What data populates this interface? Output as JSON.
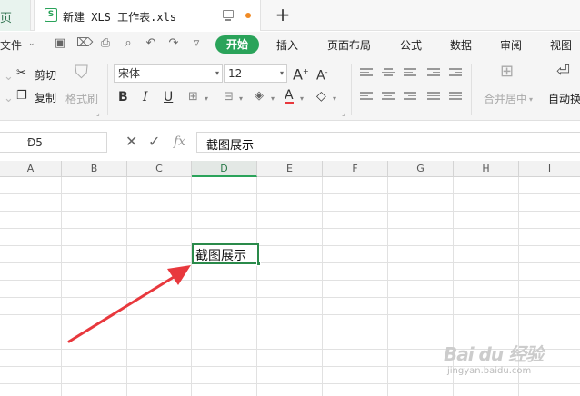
{
  "tabs": {
    "prev_label": "页",
    "active_title": "新建 XLS 工作表.xls",
    "xls_icon": "S",
    "new_tab": "+"
  },
  "menu": {
    "file": "文件",
    "start": "开始",
    "items": [
      "插入",
      "页面布局",
      "公式",
      "数据",
      "审阅",
      "视图"
    ]
  },
  "ribbon": {
    "cut": "剪切",
    "copy": "复制",
    "format_painter": "格式刷",
    "font_name": "宋体",
    "font_size": "12",
    "bold": "B",
    "italic": "I",
    "underline": "U",
    "font_color_letter": "A",
    "merge_center": "合并居中",
    "auto_wrap": "自动换"
  },
  "formula_bar": {
    "cell_ref": "D5",
    "fx": "fx",
    "content": "截图展示"
  },
  "grid": {
    "columns": [
      "A",
      "B",
      "C",
      "D",
      "E",
      "F",
      "G",
      "H",
      "I"
    ],
    "active_column": "D",
    "selected_cell_text": "截图展示"
  },
  "watermark": {
    "text": "Bai du 经验",
    "url": "jingyan.baidu.com"
  },
  "colors": {
    "accent": "#2aa35a",
    "arrow": "#e8383d"
  }
}
